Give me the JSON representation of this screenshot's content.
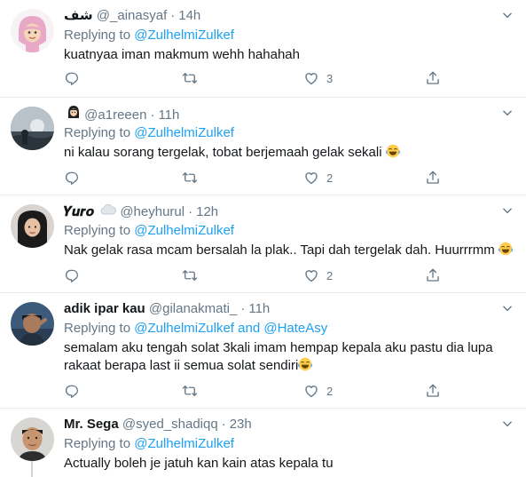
{
  "tweets": [
    {
      "name": "شف",
      "handle": "@_ainasyaf",
      "dot": "·",
      "time": "14h",
      "replying_prefix": "Replying to",
      "mention": "@ZulhelmiZulkef",
      "text": "kuatnyaa iman makmum wehh hahahah",
      "likes": "3"
    },
    {
      "name": "",
      "handle": "@a1reeen",
      "dot": "·",
      "time": "11h",
      "replying_prefix": "Replying to",
      "mention": "@ZulhelmiZulkef",
      "text": "ni kalau sorang tergelak, tobat berjemaah gelak sekali",
      "likes": "2"
    },
    {
      "name": "𝒀𝒖𝒓𝒐",
      "handle": "@heyhurul",
      "dot": "·",
      "time": "12h",
      "replying_prefix": "Replying to",
      "mention": "@ZulhelmiZulkef",
      "text": "Nak gelak rasa mcam bersalah la plak.. Tapi dah tergelak dah. Huurrrmm",
      "likes": "2"
    },
    {
      "name": "adik ipar kau",
      "handle": "@gilanakmati_",
      "dot": "·",
      "time": "11h",
      "replying_prefix": "Replying to",
      "mention": "@ZulhelmiZulkef",
      "mention_joiner": "and",
      "mention2": "@HateAsy",
      "text_line1": "semalam aku tengah solat 3kali imam hempap kepala aku pastu dia lupa",
      "text_line2": "rakaat berapa last ii semua solat sendiri",
      "likes": "2"
    },
    {
      "name": "Mr. Sega",
      "handle": "@syed_shadiqq",
      "dot": "·",
      "time": "23h",
      "replying_prefix": "Replying to",
      "mention": "@ZulhelmiZulkef",
      "text": "Actually boleh je jatuh kan kain atas kepala tu"
    }
  ],
  "icons": {
    "reply": "reply-icon",
    "retweet": "retweet-icon",
    "like": "like-icon",
    "share": "share-icon",
    "caret": "chevron-down-icon",
    "emoji": "tears-of-joy-emoji-icon"
  },
  "colors": {
    "accent": "#1da1f2",
    "secondary_text": "#657786",
    "divider": "#e6ecf0"
  }
}
